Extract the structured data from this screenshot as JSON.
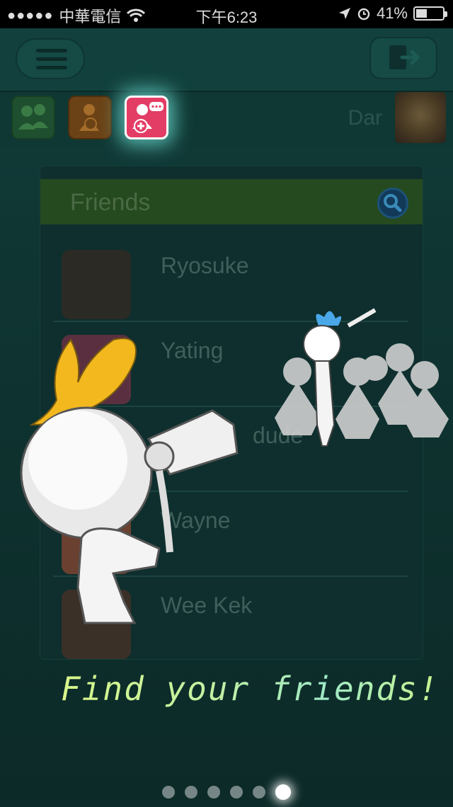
{
  "status_bar": {
    "carrier": "中華電信",
    "time": "下午6:23",
    "battery": "41%",
    "battery_level": 0.41
  },
  "header": {
    "user_name": "Dar"
  },
  "friends_panel": {
    "title": "Friends",
    "friends": [
      {
        "name": "Ryosuke"
      },
      {
        "name": "Yating"
      },
      {
        "name": "dude"
      },
      {
        "name": "Wayne"
      },
      {
        "name": "Wee Kek"
      }
    ]
  },
  "tutorial": {
    "tagline": "Find your friends!",
    "page_count": 6,
    "active_page": 6
  },
  "colors": {
    "tab_friends": "#1e4f2e",
    "tab_profile": "#6b4216",
    "tab_add_friend": "#e33d66",
    "highlight_glow": "#78f0e6"
  },
  "icons": [
    "signal-dots-icon",
    "wifi-icon",
    "location-icon",
    "alarm-icon",
    "battery-icon",
    "menu-icon",
    "logout-icon",
    "friends-group-icon",
    "profile-icon",
    "add-friend-icon",
    "search-icon"
  ]
}
